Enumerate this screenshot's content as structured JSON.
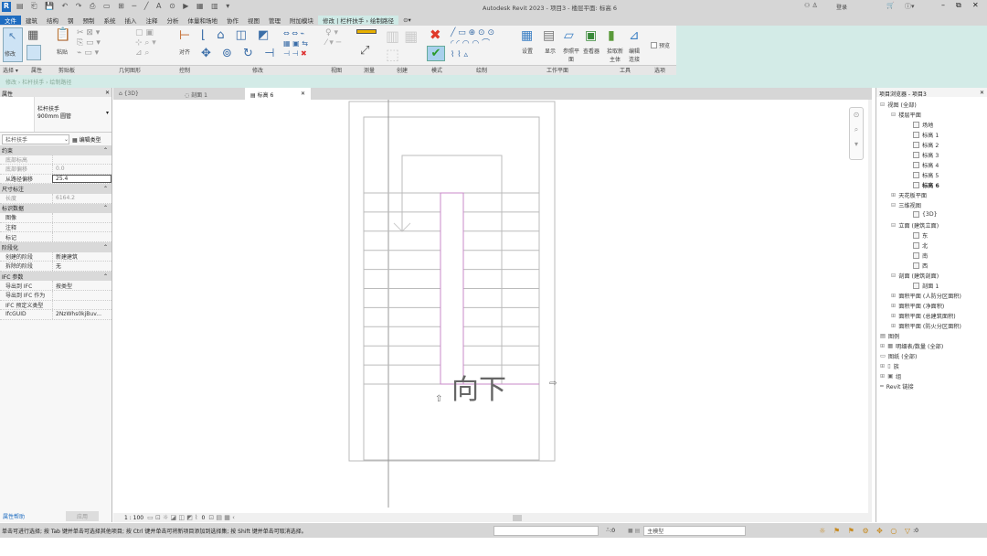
{
  "title": "Autodesk Revit 2023 - 项目3 - 楼层平面: 标高 6",
  "titlebar": {
    "user": "登录"
  },
  "menu": [
    "文件",
    "建筑",
    "结构",
    "钢",
    "预制",
    "系统",
    "插入",
    "注释",
    "分析",
    "体量和场地",
    "协作",
    "视图",
    "管理",
    "附加模块",
    "修改 | 栏杆扶手 › 绘制路径"
  ],
  "ribbon": {
    "buttons": {
      "modify": "修改",
      "paste": "粘贴",
      "align": "对齐",
      "copy": "复制",
      "cut": "剪切",
      "join": "连接",
      "pick_line": "拾取线",
      "set": "设置",
      "show": "显示",
      "ref_plane": "参照平面",
      "viewer": "查看器",
      "pick_host": "拾取新主体",
      "edit_join": "编辑连接",
      "preview": "预览"
    },
    "panels": [
      "选择 ▾",
      "属性",
      "剪贴板",
      "几何图形",
      "控制",
      "修改",
      "视图",
      "测量",
      "创建",
      "模式",
      "绘制",
      "工作平面",
      "工具",
      "选项"
    ]
  },
  "breadcrumb": "修改 › 栏杆扶手 › 绘制路径",
  "properties": {
    "title": "属性",
    "type_line1": "栏杆扶手",
    "type_line2": "900mm 圆管",
    "selector": "栏杆扶手",
    "edit_type": "编辑类型",
    "groups": [
      {
        "name": "约束",
        "rows": [
          {
            "k": "底部标高",
            "v": "",
            "grey": true
          },
          {
            "k": "底部偏移",
            "v": "0.0",
            "grey": true
          },
          {
            "k": "从路径偏移",
            "v": "25.4",
            "input": true
          }
        ]
      },
      {
        "name": "尺寸标注",
        "rows": [
          {
            "k": "长度",
            "v": "6164.2",
            "grey": true
          }
        ]
      },
      {
        "name": "标识数据",
        "rows": [
          {
            "k": "图像",
            "v": ""
          },
          {
            "k": "注释",
            "v": ""
          },
          {
            "k": "标记",
            "v": ""
          }
        ]
      },
      {
        "name": "阶段化",
        "rows": [
          {
            "k": "创建的阶段",
            "v": "新建建筑"
          },
          {
            "k": "拆除的阶段",
            "v": "无"
          }
        ]
      },
      {
        "name": "IFC 参数",
        "rows": [
          {
            "k": "导出到 IFC",
            "v": "按类型"
          },
          {
            "k": "导出到 IFC 作为",
            "v": ""
          },
          {
            "k": "IFC 预定义类型",
            "v": ""
          },
          {
            "k": "IfcGUID",
            "v": "2NzWhs0kjBuv..."
          }
        ]
      }
    ],
    "help": "属性帮助",
    "apply": "应用"
  },
  "tabs": [
    {
      "label": "{3D}",
      "active": false
    },
    {
      "label": "剖面 1",
      "active": false
    },
    {
      "label": "标高 6",
      "active": true
    }
  ],
  "drawing": {
    "label": "向下"
  },
  "browser": {
    "title": "项目浏览器 - 项目3",
    "items": [
      {
        "t": "视图 (全部)",
        "lvl": 0,
        "exp": "⊟"
      },
      {
        "t": "楼层平面",
        "lvl": 1,
        "exp": "⊟"
      },
      {
        "t": "场地",
        "lvl": 2,
        "box": true
      },
      {
        "t": "标高 1",
        "lvl": 2,
        "box": true
      },
      {
        "t": "标高 2",
        "lvl": 2,
        "box": true
      },
      {
        "t": "标高 3",
        "lvl": 2,
        "box": true
      },
      {
        "t": "标高 4",
        "lvl": 2,
        "box": true
      },
      {
        "t": "标高 5",
        "lvl": 2,
        "box": true
      },
      {
        "t": "标高 6",
        "lvl": 2,
        "box": true,
        "bold": true
      },
      {
        "t": "天花板平面",
        "lvl": 1,
        "exp": "⊞"
      },
      {
        "t": "三维视图",
        "lvl": 1,
        "exp": "⊟"
      },
      {
        "t": "{3D}",
        "lvl": 2,
        "box": true
      },
      {
        "t": "立面 (建筑立面)",
        "lvl": 1,
        "exp": "⊟"
      },
      {
        "t": "东",
        "lvl": 2,
        "box": true
      },
      {
        "t": "北",
        "lvl": 2,
        "box": true
      },
      {
        "t": "南",
        "lvl": 2,
        "box": true
      },
      {
        "t": "西",
        "lvl": 2,
        "box": true
      },
      {
        "t": "剖面 (建筑剖面)",
        "lvl": 1,
        "exp": "⊟"
      },
      {
        "t": "剖面 1",
        "lvl": 2,
        "box": true
      },
      {
        "t": "面积平面 (人防分区面积)",
        "lvl": 1,
        "exp": "⊞"
      },
      {
        "t": "面积平面 (净面积)",
        "lvl": 1,
        "exp": "⊞"
      },
      {
        "t": "面积平面 (总建筑面积)",
        "lvl": 1,
        "exp": "⊞"
      },
      {
        "t": "面积平面 (防火分区面积)",
        "lvl": 1,
        "exp": "⊞"
      },
      {
        "t": "图例",
        "lvl": 0,
        "icon": "▤"
      },
      {
        "t": "明细表/数量 (全部)",
        "lvl": 0,
        "exp": "⊞",
        "icon": "▦"
      },
      {
        "t": "图纸 (全部)",
        "lvl": 0,
        "icon": "▭"
      },
      {
        "t": "族",
        "lvl": 0,
        "exp": "⊞",
        "icon": "▯"
      },
      {
        "t": "组",
        "lvl": 0,
        "exp": "⊞",
        "icon": "▣"
      },
      {
        "t": "Revit 链接",
        "lvl": 0,
        "icon": "═"
      }
    ]
  },
  "viewbar": {
    "scale": "1 : 100",
    "count": "0"
  },
  "status": {
    "hint": "单击可进行选择; 按 Tab 键并单击可选择其他项目; 按 Ctrl 键并单击可将新项目添加到选择集; 按 Shift 键并单击可取消选择。",
    "coord": ":0",
    "model": "主模型",
    "filter": ":0"
  },
  "colors": {
    "accent": "#1e6cc0",
    "ribbon_context": "#d3ebe7",
    "sketch": "#c06ec0"
  }
}
